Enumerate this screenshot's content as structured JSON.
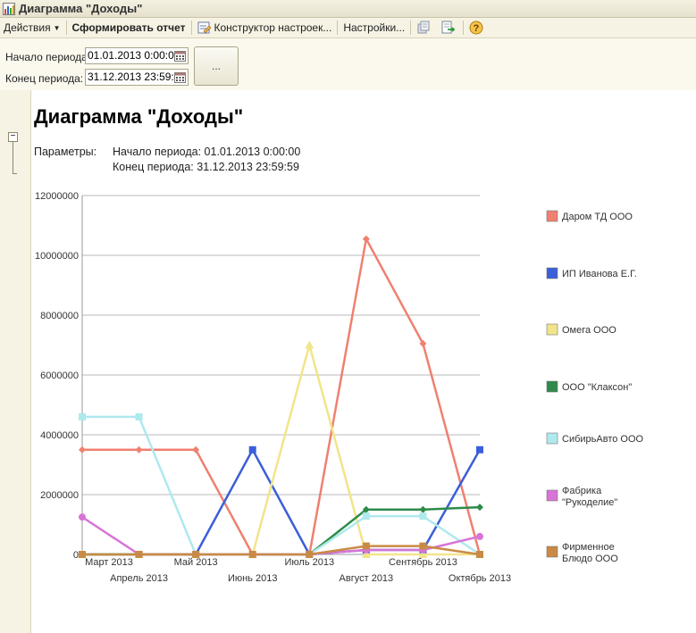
{
  "window": {
    "title": "Диаграмма \"Доходы\""
  },
  "toolbar": {
    "actions": "Действия",
    "generate": "Сформировать отчет",
    "constructor": "Конструктор настроек...",
    "settings": "Настройки..."
  },
  "params": {
    "start_label": "Начало периода:",
    "start_value": "01.01.2013  0:00:00",
    "end_label": "Конец периода:",
    "end_value": "31.12.2013 23:59:59",
    "dots": "..."
  },
  "report": {
    "title": "Диаграмма \"Доходы\"",
    "params_label": "Параметры:",
    "param1": "Начало периода: 01.01.2013 0:00:00",
    "param2": "Конец периода: 31.12.2013 23:59:59"
  },
  "chart_data": {
    "type": "line",
    "categories": [
      "Март 2013",
      "Апрель 2013",
      "Май 2013",
      "Июнь 2013",
      "Июль 2013",
      "Август 2013",
      "Сентябрь 2013",
      "Октябрь 2013"
    ],
    "y_ticks": [
      "0",
      "2000000",
      "4000000",
      "6000000",
      "8000000",
      "10000000",
      "12000000"
    ],
    "ylim": [
      0,
      12000000
    ],
    "grid": true,
    "legend_position": "right",
    "series": [
      {
        "name": "Даром ТД ООО",
        "color": "#f08070",
        "marker": "diamond",
        "values": [
          3500000,
          3500000,
          3500000,
          0,
          0,
          10550000,
          7050000,
          0
        ]
      },
      {
        "name": "ИП Иванова Е.Г.",
        "color": "#3b5fd8",
        "marker": "square",
        "values": [
          0,
          0,
          0,
          3500000,
          0,
          150000,
          150000,
          3500000
        ]
      },
      {
        "name": "Омега ООО",
        "color": "#f2e48a",
        "marker": "triangle",
        "values": [
          0,
          0,
          0,
          0,
          7000000,
          0,
          0,
          0
        ]
      },
      {
        "name": "ООО \"Клаксон\"",
        "color": "#2e8b4a",
        "marker": "diamond",
        "values": [
          0,
          0,
          0,
          0,
          0,
          1500000,
          1500000,
          1580000
        ]
      },
      {
        "name": "СибирьАвто ООО",
        "color": "#aee9ee",
        "marker": "square",
        "values": [
          4600000,
          4600000,
          0,
          0,
          0,
          1280000,
          1280000,
          0
        ]
      },
      {
        "name": "Фабрика \"Рукоделие\"",
        "color": "#d874d6",
        "marker": "circle",
        "values": [
          1250000,
          0,
          0,
          0,
          0,
          150000,
          150000,
          600000
        ]
      },
      {
        "name": "Фирменное Блюдо ООО",
        "color": "#c98a45",
        "marker": "square",
        "values": [
          0,
          0,
          0,
          0,
          0,
          280000,
          280000,
          0
        ]
      }
    ]
  }
}
